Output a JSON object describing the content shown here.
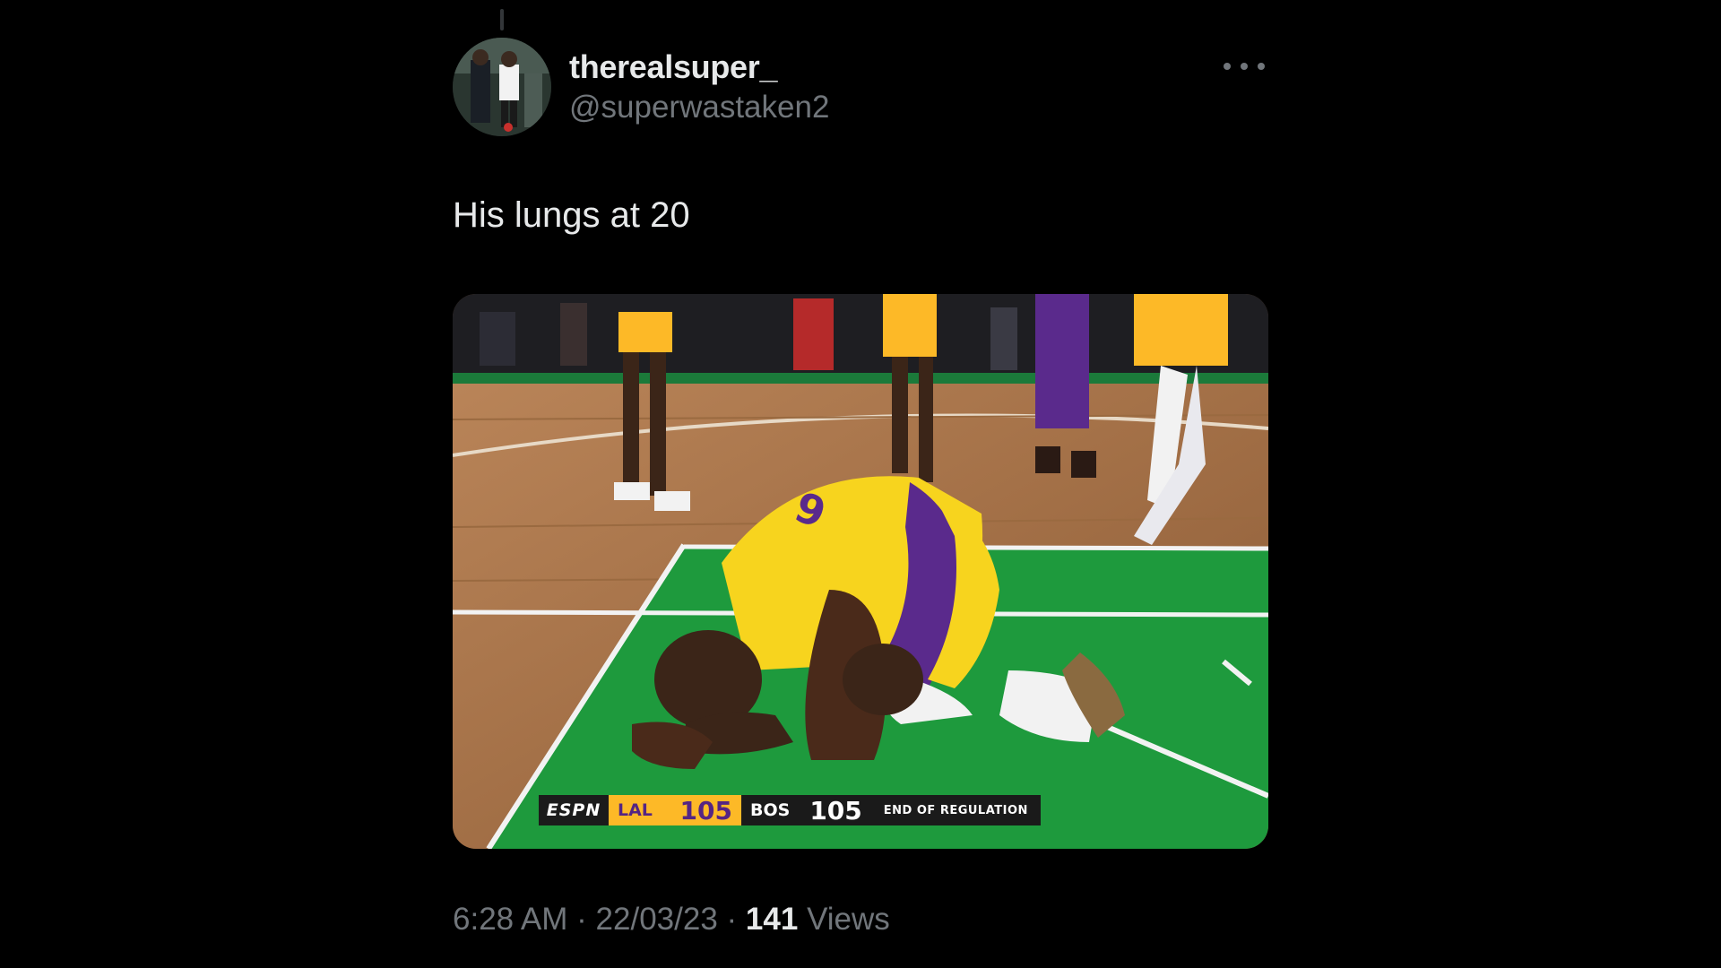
{
  "author": {
    "display_name": "therealsuper_",
    "handle": "@superwastaken2"
  },
  "tweet": {
    "text": "His lungs at 20"
  },
  "media": {
    "scorebug": {
      "network": "ESPN",
      "home_team": "LAL",
      "home_score": "105",
      "away_team": "BOS",
      "away_score": "105",
      "status": "END OF REGULATION"
    }
  },
  "meta": {
    "time": "6:28 AM",
    "separator": "·",
    "date": "22/03/23",
    "views_count": "141",
    "views_label": "Views"
  },
  "icons": {
    "more": "more-horizontal-icon"
  },
  "colors": {
    "background": "#000000",
    "text_primary": "#e7e9ea",
    "text_secondary": "#71767b",
    "lakers_gold": "#fdb927",
    "lakers_purple": "#552583",
    "court_green": "#1e9a3d"
  }
}
